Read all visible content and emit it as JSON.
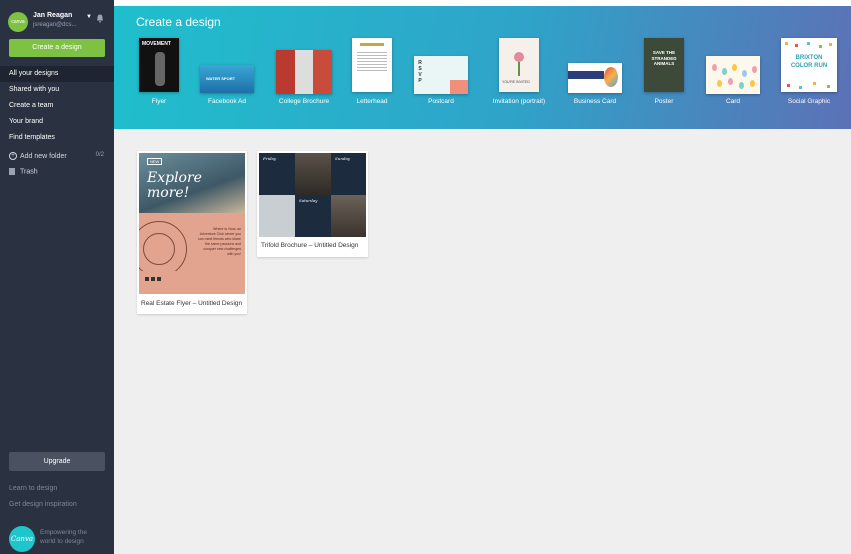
{
  "user": {
    "name": "Jan Reagan",
    "email": "jsreagan@dcs...",
    "avatar_text": "canva"
  },
  "sidebar": {
    "create_label": "Create a design",
    "items": [
      {
        "label": "All your designs"
      },
      {
        "label": "Shared with you"
      },
      {
        "label": "Create a team"
      },
      {
        "label": "Your brand"
      },
      {
        "label": "Find templates"
      }
    ],
    "add_folder_label": "Add new folder",
    "folder_count": "0/2",
    "trash_label": "Trash",
    "upgrade_label": "Upgrade",
    "learn_label": "Learn to design",
    "inspiration_label": "Get design inspiration",
    "logo_text": "Canva",
    "tagline": "Empowering the world to design"
  },
  "banner": {
    "title": "Create a design",
    "templates": [
      {
        "label": "Flyer",
        "thumb_text": "MOVEMENT"
      },
      {
        "label": "Facebook Ad",
        "thumb_text": "WATER SPORT"
      },
      {
        "label": "College Brochure",
        "thumb_text": ""
      },
      {
        "label": "Letterhead",
        "thumb_text": ""
      },
      {
        "label": "Postcard",
        "thumb_text": "RSVP"
      },
      {
        "label": "Invitation (portrait)",
        "thumb_text": "YOU'RE INVITED"
      },
      {
        "label": "Business Card",
        "thumb_text": ""
      },
      {
        "label": "Poster",
        "thumb_text": "SAVE THE STRANDED ANIMALS"
      },
      {
        "label": "Card",
        "thumb_text": ""
      },
      {
        "label": "Social Graphic",
        "thumb_text": "BRIXTON COLOR RUN"
      }
    ]
  },
  "designs": [
    {
      "label": "Real Estate Flyer – Untitled Design",
      "headline": "Explore more!",
      "tag": "NEW",
      "body": "Where to Now, an Adventure Club where you can meet friends who share the same passions and conquer new challenges with you!"
    },
    {
      "label": "Trifold Brochure – Untitled Design",
      "panels": [
        "Friday",
        "Sunday",
        "Saturday"
      ]
    }
  ],
  "colors": {
    "accent": "#7dc242",
    "sidebar": "#2a3140",
    "banner_start": "#1fbfcc",
    "banner_end": "#5c71b6"
  }
}
